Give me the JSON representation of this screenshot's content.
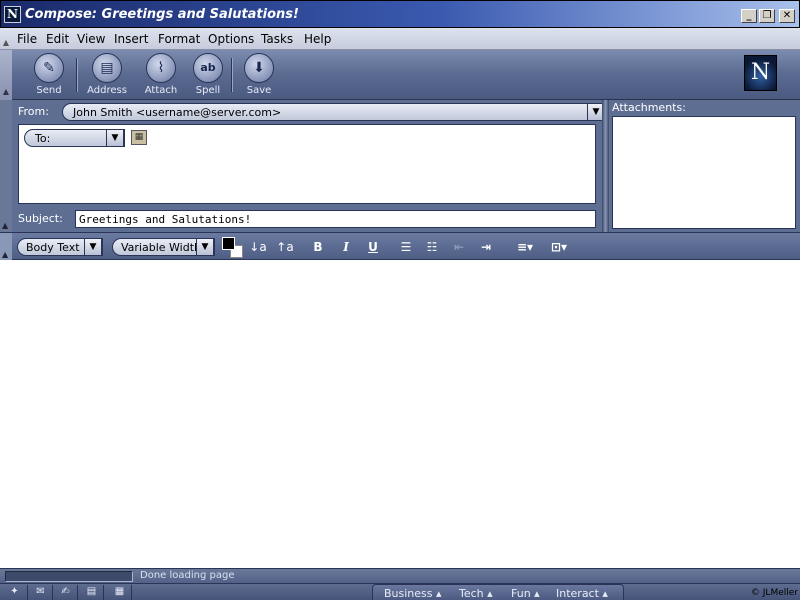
{
  "window": {
    "title": "Compose: Greetings and Salutations!",
    "app_icon": "N",
    "controls": {
      "minimize": "_",
      "restore": "❐",
      "close": "✕"
    }
  },
  "menu": [
    "File",
    "Edit",
    "View",
    "Insert",
    "Format",
    "Options",
    "Tasks",
    "Help"
  ],
  "toolbar": {
    "buttons": [
      {
        "label": "Send",
        "icon": "send-icon",
        "glyph": "✎"
      },
      {
        "label": "Address",
        "icon": "address-book-icon",
        "glyph": "▤"
      },
      {
        "label": "Attach",
        "icon": "paperclip-icon",
        "glyph": "⌇"
      },
      {
        "label": "Spell",
        "icon": "spellcheck-icon",
        "glyph": "ab"
      },
      {
        "label": "Save",
        "icon": "save-icon",
        "glyph": "⬇"
      }
    ],
    "logo": "N"
  },
  "compose": {
    "from_label": "From:",
    "from_value": "John Smith <username@server.com>",
    "to_label": "To:",
    "subject_label": "Subject:",
    "subject_value": "Greetings and Salutations!",
    "attachments_label": "Attachments:"
  },
  "format": {
    "paragraph_style": "Body Text",
    "font": "Variable Width",
    "text_color": "#000000",
    "background_color": "#ffffff",
    "buttons": {
      "decrease_font": "↓a",
      "increase_font": "↑a",
      "bold": "B",
      "italic": "I",
      "underline": "U",
      "bullets": "☰",
      "numbered": "☷",
      "outdent": "⇤",
      "indent": "⇥",
      "align": "≡▾",
      "insert": "⊡▾"
    }
  },
  "status": {
    "text": "Done loading page"
  },
  "taskbar": {
    "icons": [
      "navigator-icon",
      "mail-icon",
      "composer-icon",
      "address-icon",
      "calendar-icon"
    ],
    "tabs": [
      "Business",
      "Tech",
      "Fun",
      "Interact"
    ],
    "credit": "© JLMeller"
  }
}
